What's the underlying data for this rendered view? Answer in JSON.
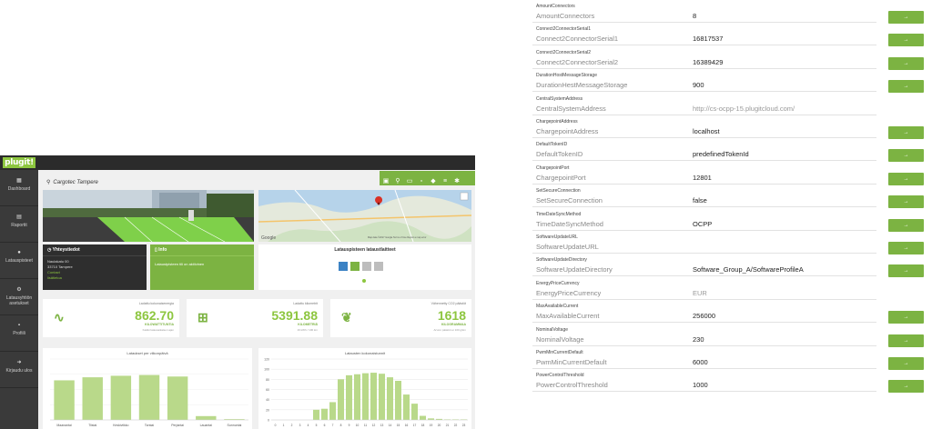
{
  "dashboard": {
    "logo": "plugit!",
    "location_title": "Cargotec Tampere",
    "sidebar": [
      {
        "icon": "dashboard-icon",
        "label": "Dashboard"
      },
      {
        "icon": "report-icon",
        "label": "Raportit"
      },
      {
        "icon": "charger-icon",
        "label": "Latauspisteet"
      },
      {
        "icon": "settings-icon",
        "label": "Latausyhtiön asetukset"
      },
      {
        "icon": "profile-icon",
        "label": "Profiili"
      },
      {
        "icon": "logout-icon",
        "label": "Kirjaudu ulos"
      }
    ],
    "contact_box": {
      "title": "Yhteystiedot",
      "address_line1": "Naulakatu 00",
      "address_line2": "33710 Tampere",
      "link1": "Contact",
      "link2": "lisätietoa"
    },
    "info_box": {
      "title": "Info",
      "text": "Lataustpisteen tili on aktiivinen"
    },
    "chargers_box": {
      "title": "Latauspisteen lataustlaitteet"
    },
    "map_attribution": "Map data ©2017 Google   Terms of Use   Report a map error",
    "stats": [
      {
        "label": "Ladattu kokonaisenergia",
        "value": "862.70",
        "unit": "KILOWATTITUNTIA",
        "sub": "Kaikki latausaikaisen ajan"
      },
      {
        "label": "Ladattu kilometrit",
        "value": "5391.88",
        "unit": "KILOMETRIÄ",
        "sub": "16 kWh / 100 km"
      },
      {
        "label": "Vähennetty CO2 päästöt",
        "value": "1618",
        "unit": "KILOGRAMMAA",
        "sub": "Arvion päästöt ei 100 g/km"
      }
    ],
    "weekday_chart": {
      "title": "Lataukset per viikonpäivä"
    },
    "hourly_chart": {
      "title": "Latausten kokonaistunnit"
    }
  },
  "chart_data": [
    {
      "type": "bar",
      "title": "Lataukset per viikonpäivä",
      "categories": [
        "Maanantai",
        "Tiistai",
        "Keskiviikko",
        "Torstai",
        "Perjantai",
        "Lauantai",
        "Sunnuntai"
      ],
      "values": [
        52,
        56,
        58,
        59,
        57,
        5,
        1
      ],
      "ylim": [
        0,
        80
      ],
      "color": "#b9d98a"
    },
    {
      "type": "bar",
      "title": "Latausten kokonaistunnit",
      "categories": [
        "0",
        "1",
        "2",
        "3",
        "4",
        "5",
        "6",
        "7",
        "8",
        "9",
        "10",
        "11",
        "12",
        "13",
        "14",
        "15",
        "16",
        "17",
        "18",
        "19",
        "20",
        "21",
        "22",
        "23"
      ],
      "values": [
        0,
        0,
        0,
        0,
        0,
        20,
        22,
        35,
        80,
        88,
        90,
        92,
        93,
        91,
        84,
        77,
        50,
        32,
        8,
        3,
        2,
        1,
        1,
        1
      ],
      "yticks": [
        0,
        20,
        40,
        60,
        80,
        100,
        120
      ],
      "ylim": [
        0,
        120
      ],
      "color": "#b9d98a"
    }
  ],
  "config": {
    "button_label": "→",
    "rows": [
      {
        "small": "AmountConnectors",
        "name": "AmountConnectors",
        "value": "8",
        "button": true,
        "muted": false
      },
      {
        "small": "Connect2ConnectorSerial1",
        "name": "Connect2ConnectorSerial1",
        "value": "16817537",
        "button": true,
        "muted": false
      },
      {
        "small": "Connect2ConnectorSerial2",
        "name": "Connect2ConnectorSerial2",
        "value": "16389429",
        "button": true,
        "muted": false
      },
      {
        "small": "DurationHostMessageStorage",
        "name": "DurationHestMessageStorage",
        "value": "900",
        "button": true,
        "muted": false
      },
      {
        "small": "CentralSystemAddress",
        "name": "CentralSystemAddress",
        "value": "http://cs-ocpp-15.plugitcloud.com/",
        "button": false,
        "muted": true
      },
      {
        "small": "ChargepointAddress",
        "name": "ChargepointAddress",
        "value": "localhost",
        "button": true,
        "muted": false
      },
      {
        "small": "DefaultTokenID",
        "name": "DefaultTokenID",
        "value": "predefinedTokenId",
        "button": true,
        "muted": false
      },
      {
        "small": "ChargepointPort",
        "name": "ChargepointPort",
        "value": "12801",
        "button": true,
        "muted": false
      },
      {
        "small": "SetSecureConnection",
        "name": "SetSecureConnection",
        "value": "false",
        "button": true,
        "muted": false
      },
      {
        "small": "TimeDateSyncMethod",
        "name": "TimeDateSyncMethod",
        "value": "OCPP",
        "button": true,
        "muted": false
      },
      {
        "small": "SoftwareUpdateURL",
        "name": "SoftwareUpdateURL",
        "value": "",
        "button": true,
        "muted": false
      },
      {
        "small": "SoftwareUpdateDirectory",
        "name": "SoftwareUpdateDirectory",
        "value": "Software_Group_A/SoftwareProfileA",
        "button": true,
        "muted": false
      },
      {
        "small": "EnergyPriceCurrency",
        "name": "EnergyPriceCurrency",
        "value": "EUR",
        "button": false,
        "muted": true
      },
      {
        "small": "MaxAvailableCurrent",
        "name": "MaxAvailableCurrent",
        "value": "256000",
        "button": true,
        "muted": false
      },
      {
        "small": "NominalVoltage",
        "name": "NominalVoltage",
        "value": "230",
        "button": true,
        "muted": false
      },
      {
        "small": "PwmMinCurrentDefault",
        "name": "PwmMinCurrentDefault",
        "value": "6000",
        "button": true,
        "muted": false
      },
      {
        "small": "PowerControlThreshold",
        "name": "PowerControlThreshold",
        "value": "1000",
        "button": true,
        "muted": false
      }
    ]
  }
}
